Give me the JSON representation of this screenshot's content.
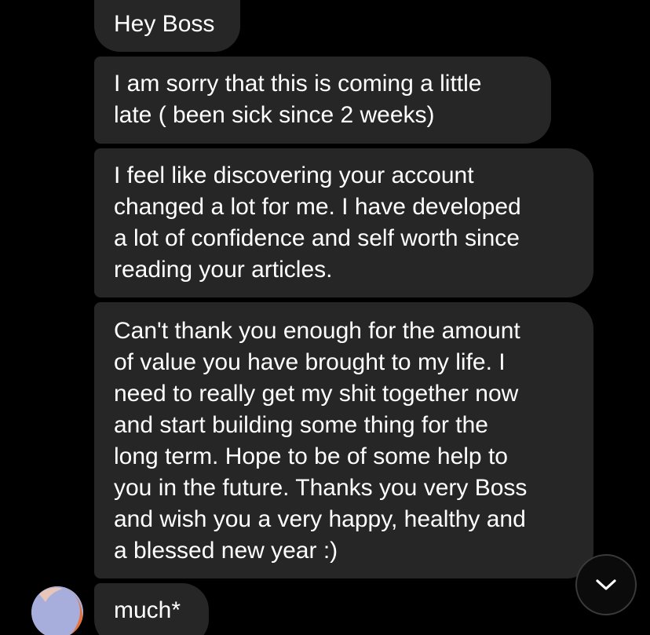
{
  "conversation": {
    "messages": [
      {
        "text": "Hey Boss"
      },
      {
        "text": "I am sorry that this is coming a little\nlate ( been sick since 2 weeks)"
      },
      {
        "text": "I feel like discovering your account\nchanged a lot for me. I have developed\na lot of confidence and self worth since\nreading your articles."
      },
      {
        "text": "Can't thank you enough for the amount\nof value you have brought to my life. I\nneed to really get my shit together now\nand start building some thing for the\nlong term. Hope to be of some help to\nyou in the future. Thanks you very Boss\nand wish you a very happy, healthy and\na blessed new year :)"
      },
      {
        "text": "much*"
      }
    ]
  },
  "theme": {
    "background": "#000000",
    "bubble": "#262626",
    "text": "#ffffff",
    "avatar_colors": [
      "#a8aedc",
      "#e8733a",
      "#f2c9b2"
    ]
  },
  "icons": {
    "scroll_down": "chevron-down-icon",
    "avatar": "avatar"
  }
}
